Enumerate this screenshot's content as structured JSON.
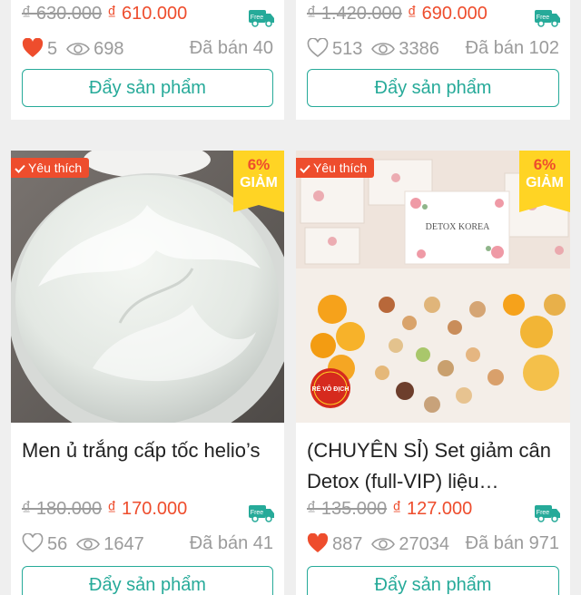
{
  "products": [
    {
      "old_price": "₫ 630.000",
      "new_price": "₫ 610.000",
      "liked": true,
      "likes": "5",
      "views": "698",
      "sold": "Đã bán 40",
      "button": "Đẩy sản phẩm"
    },
    {
      "old_price": "₫ 1.420.000",
      "new_price": "₫ 690.000",
      "liked": false,
      "likes": "513",
      "views": "3386",
      "sold": "Đã bán 102",
      "button": "Đẩy sản phẩm"
    },
    {
      "badge": "Yêu thích",
      "discount_pct": "6%",
      "discount_word": "GIẢM",
      "title": "Men ủ trắng cấp tốc helio’s",
      "old_price": "₫ 180.000",
      "new_price": "₫ 170.000",
      "liked": false,
      "likes": "56",
      "views": "1647",
      "sold": "Đã bán 41",
      "button": "Đẩy sản phẩm"
    },
    {
      "badge": "Yêu thích",
      "discount_pct": "6%",
      "discount_word": "GIẢM",
      "image_text": "DETOX KOREA",
      "stamp_text": "RẺ VÔ ĐỊCH",
      "title": "(CHUYÊN SỈ) Set giảm cân Detox (full-VIP) liệu…",
      "old_price": "₫ 135.000",
      "new_price": "₫ 127.000",
      "liked": true,
      "likes": "887",
      "views": "27034",
      "sold": "Đã bán 971",
      "button": "Đẩy sản phẩm"
    }
  ],
  "colors": {
    "accent": "#ee4d2d",
    "teal": "#26aa99",
    "badge_yellow": "#ffd424"
  },
  "icons": {
    "free_shipping": "free-shipping-truck-icon",
    "like": "heart-icon",
    "views": "eye-icon"
  }
}
